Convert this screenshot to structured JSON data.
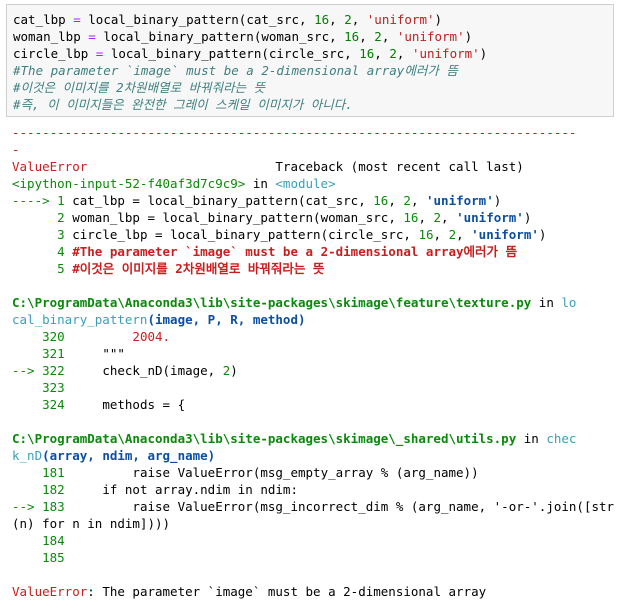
{
  "input_cell": {
    "lines": [
      {
        "var": "cat_lbp",
        "src": "cat_src"
      },
      {
        "var": "woman_lbp",
        "src": "woman_src"
      },
      {
        "var": "circle_lbp",
        "src": "circle_src"
      }
    ],
    "eq": " = ",
    "fn": "local_binary_pattern",
    "open": "(",
    "sep": ", ",
    "p": "16",
    "r": "2",
    "method": "'uniform'",
    "close": ")",
    "comment1": "#The parameter `image` must be a 2-dimensional array에러가 뜸",
    "comment2": "#이것은 이미지를 2차원배열로 바꿔줘라는 뜻",
    "comment3": "#즉, 이 이미지들은 완전한 그레이 스케일 이미지가 아니다."
  },
  "traceback": {
    "dashes": "---------------------------------------------------------------------------",
    "dash_tail": "-",
    "error_name": "ValueError",
    "traceback_label": "Traceback (most recent call last)",
    "input_ref": "<ipython-input-52-f40af3d7c9c9>",
    "in_word": " in ",
    "module": "<module>",
    "frame1": {
      "l1_arrow": "----> 1 ",
      "l2_num": "      2 ",
      "l3_num": "      3 ",
      "l4_num": "      4 ",
      "l5_num": "      5 ",
      "cat": "cat_lbp",
      "woman": "woman_lbp",
      "circle": "circle_lbp",
      "cat_src": "cat_src",
      "woman_src": "woman_src",
      "circle_src": "circle_src",
      "comment4": "#The parameter `image` must be a 2-dimensional array에러가 뜸",
      "comment5": "#이것은 이미지를 2차원배열로 바꿔줘라는 뜻"
    },
    "frame2": {
      "path": "C:\\ProgramData\\Anaconda3\\lib\\site-packages\\skimage\\feature\\texture.py",
      "in": " in ",
      "func_a": "lo",
      "func_b": "cal_binary_pattern",
      "args": "(image, P, R, method)",
      "l320": "    320 ",
      "l320_text": "        2004.",
      "l321": "    321 ",
      "l321_text": "    \"\"\"",
      "l322": "--> 322 ",
      "l322_text": "    check_nD(image, ",
      "l322_num": "2",
      "l322_end": ")",
      "l323": "    323",
      "l324": "    324 ",
      "l324_text": "    methods = {"
    },
    "frame3": {
      "path": "C:\\ProgramData\\Anaconda3\\lib\\site-packages\\skimage\\_shared\\utils.py",
      "in": " in ",
      "func_a": "chec",
      "func_b": "k_nD",
      "args": "(array, ndim, arg_name)",
      "l181": "    181 ",
      "l181_text": "        raise ValueError(msg_empty_array % (arg_name))",
      "l182": "    182 ",
      "l182_text": "    if not array.ndim in ndim:",
      "l183": "--> 183 ",
      "l183_text": "        raise ValueError(msg_incorrect_dim % (arg_name, '-or-'.join([str",
      "l183_cont": "(n) for n in ndim]))",
      "l183_close": ")",
      "l184": "    184",
      "l185": "    185"
    },
    "final_name": "ValueError",
    "final_msg": ": The parameter `image` must be a 2-dimensional array"
  }
}
